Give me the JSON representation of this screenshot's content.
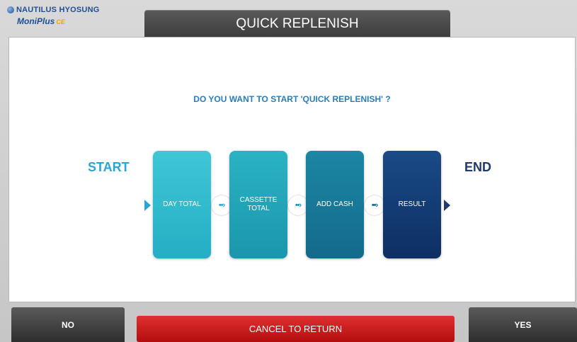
{
  "brand": {
    "company": "NAUTILUS HYOSUNG",
    "product": "MoniPlus",
    "product_suffix": "CE"
  },
  "header": {
    "title": "QUICK REPLENISH"
  },
  "main": {
    "question": "DO YOU WANT TO START 'QUICK REPLENISH' ?",
    "flow": {
      "start_label": "START",
      "end_label": "END",
      "steps": [
        {
          "label": "DAY TOTAL"
        },
        {
          "label": "CASSETTE\nTOTAL"
        },
        {
          "label": "ADD CASH"
        },
        {
          "label": "RESULT"
        }
      ],
      "connector_glyph": "••›"
    }
  },
  "buttons": {
    "no_label": "NO",
    "cancel_label": "CANCEL TO RETURN",
    "yes_label": "YES"
  },
  "colors": {
    "accent_blue": "#2aa6d4",
    "dark_blue": "#1e3a6e",
    "cancel_red": "#c41515"
  }
}
